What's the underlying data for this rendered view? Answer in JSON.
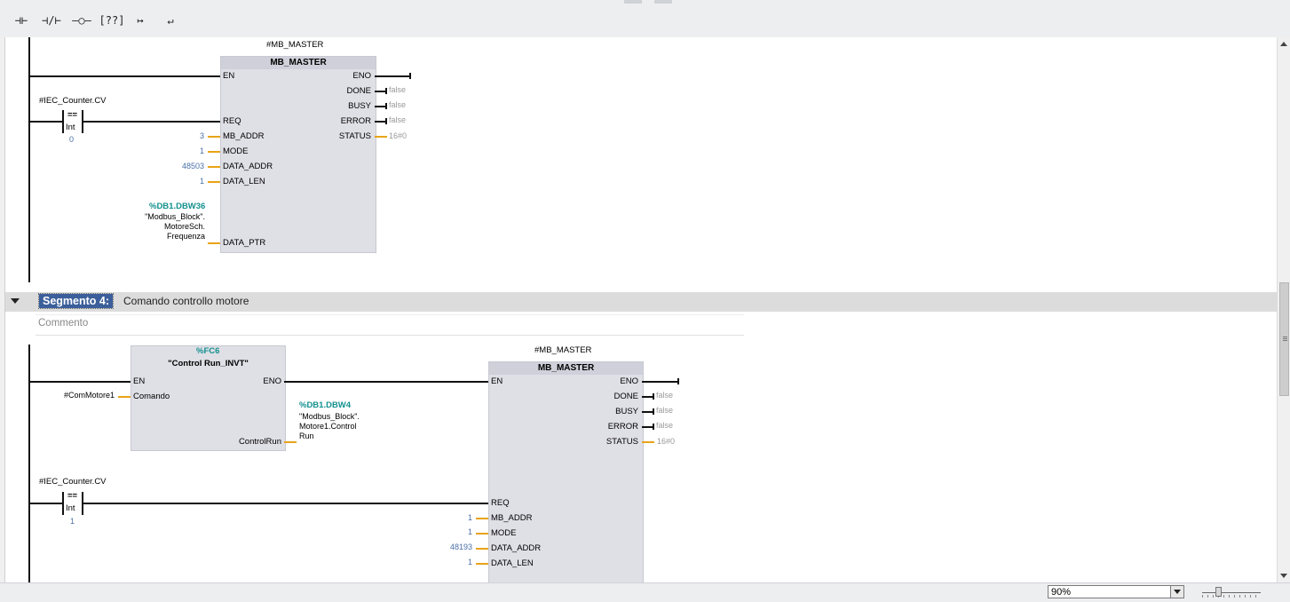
{
  "toolbar": {
    "buttons": [
      {
        "glyph": "⊣⊢",
        "name": "no-contact"
      },
      {
        "glyph": "⊣/⊢",
        "name": "nc-contact"
      },
      {
        "glyph": "–○–",
        "name": "coil"
      },
      {
        "glyph": "[??]",
        "name": "empty-box"
      },
      {
        "glyph": "↦",
        "name": "open-branch"
      },
      {
        "glyph": "↵",
        "name": "close-branch"
      }
    ]
  },
  "seg3": {
    "instance": "#MB_MASTER",
    "block_name": "MB_MASTER",
    "contact_var": "#IEC_Counter.CV",
    "contact_op": "==",
    "contact_type": "Int",
    "contact_val": "0",
    "inputs": [
      "EN",
      "REQ",
      "MB_ADDR",
      "MODE",
      "DATA_ADDR",
      "DATA_LEN",
      "DATA_PTR"
    ],
    "in_vals": {
      "mb_addr": "3",
      "mode": "1",
      "data_addr": "48503",
      "data_len": "1"
    },
    "outputs": [
      "ENO",
      "DONE",
      "BUSY",
      "ERROR",
      "STATUS"
    ],
    "out_vals": {
      "done": "false",
      "busy": "false",
      "error": "false",
      "status": "16#0"
    },
    "ptr_addr": "%DB1.DBW36",
    "ptr_lines": [
      "\"Modbus_Block\".",
      "MotoreSch.",
      "Frequenza"
    ]
  },
  "seg4": {
    "label": "Segmento 4:",
    "title": "Comando controllo motore",
    "comment": "Commento",
    "fc_addr": "%FC6",
    "fc_name": "\"Control Run_INVT\"",
    "fc_en": "EN",
    "fc_eno": "ENO",
    "fc_in": "Comando",
    "fc_in_var": "#ComMotore1",
    "fc_out": "ControlRun",
    "fc_out_addr": "%DB1.DBW4",
    "fc_out_lines": [
      "\"Modbus_Block\".",
      "Motore1.Control",
      "Run"
    ],
    "instance": "#MB_MASTER",
    "block_name": "MB_MASTER",
    "contact_var": "#IEC_Counter.CV",
    "contact_op": "==",
    "contact_type": "Int",
    "contact_val": "1",
    "inputs": [
      "EN",
      "REQ",
      "MB_ADDR",
      "MODE",
      "DATA_ADDR",
      "DATA_LEN"
    ],
    "in_vals": {
      "mb_addr": "1",
      "mode": "1",
      "data_addr": "48193",
      "data_len": "1"
    },
    "outputs": [
      "ENO",
      "DONE",
      "BUSY",
      "ERROR",
      "STATUS"
    ],
    "out_vals": {
      "done": "false",
      "busy": "false",
      "error": "false",
      "status": "16#0"
    }
  },
  "status": {
    "zoom": "90%"
  }
}
